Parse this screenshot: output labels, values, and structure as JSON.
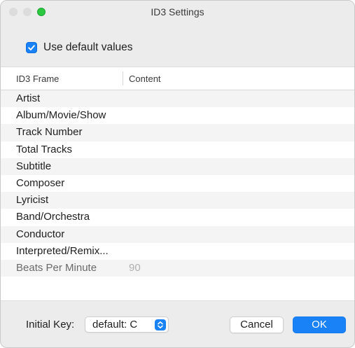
{
  "window": {
    "title": "ID3 Settings"
  },
  "use_default": {
    "label": "Use default values",
    "checked": true
  },
  "table": {
    "headers": {
      "frame": "ID3 Frame",
      "content": "Content"
    },
    "rows": [
      {
        "frame": "Artist",
        "content": ""
      },
      {
        "frame": "Album/Movie/Show",
        "content": ""
      },
      {
        "frame": "Track Number",
        "content": ""
      },
      {
        "frame": "Total Tracks",
        "content": ""
      },
      {
        "frame": "Subtitle",
        "content": ""
      },
      {
        "frame": "Composer",
        "content": ""
      },
      {
        "frame": "Lyricist",
        "content": ""
      },
      {
        "frame": "Band/Orchestra",
        "content": ""
      },
      {
        "frame": "Conductor",
        "content": ""
      },
      {
        "frame": "Interpreted/Remix...",
        "content": ""
      },
      {
        "frame": "Beats Per Minute",
        "content": "90"
      }
    ]
  },
  "footer": {
    "initial_key_label": "Initial Key:",
    "initial_key_value": "default: C",
    "cancel_label": "Cancel",
    "ok_label": "OK"
  },
  "colors": {
    "accent": "#1a82f7",
    "zoom": "#2bc840"
  }
}
